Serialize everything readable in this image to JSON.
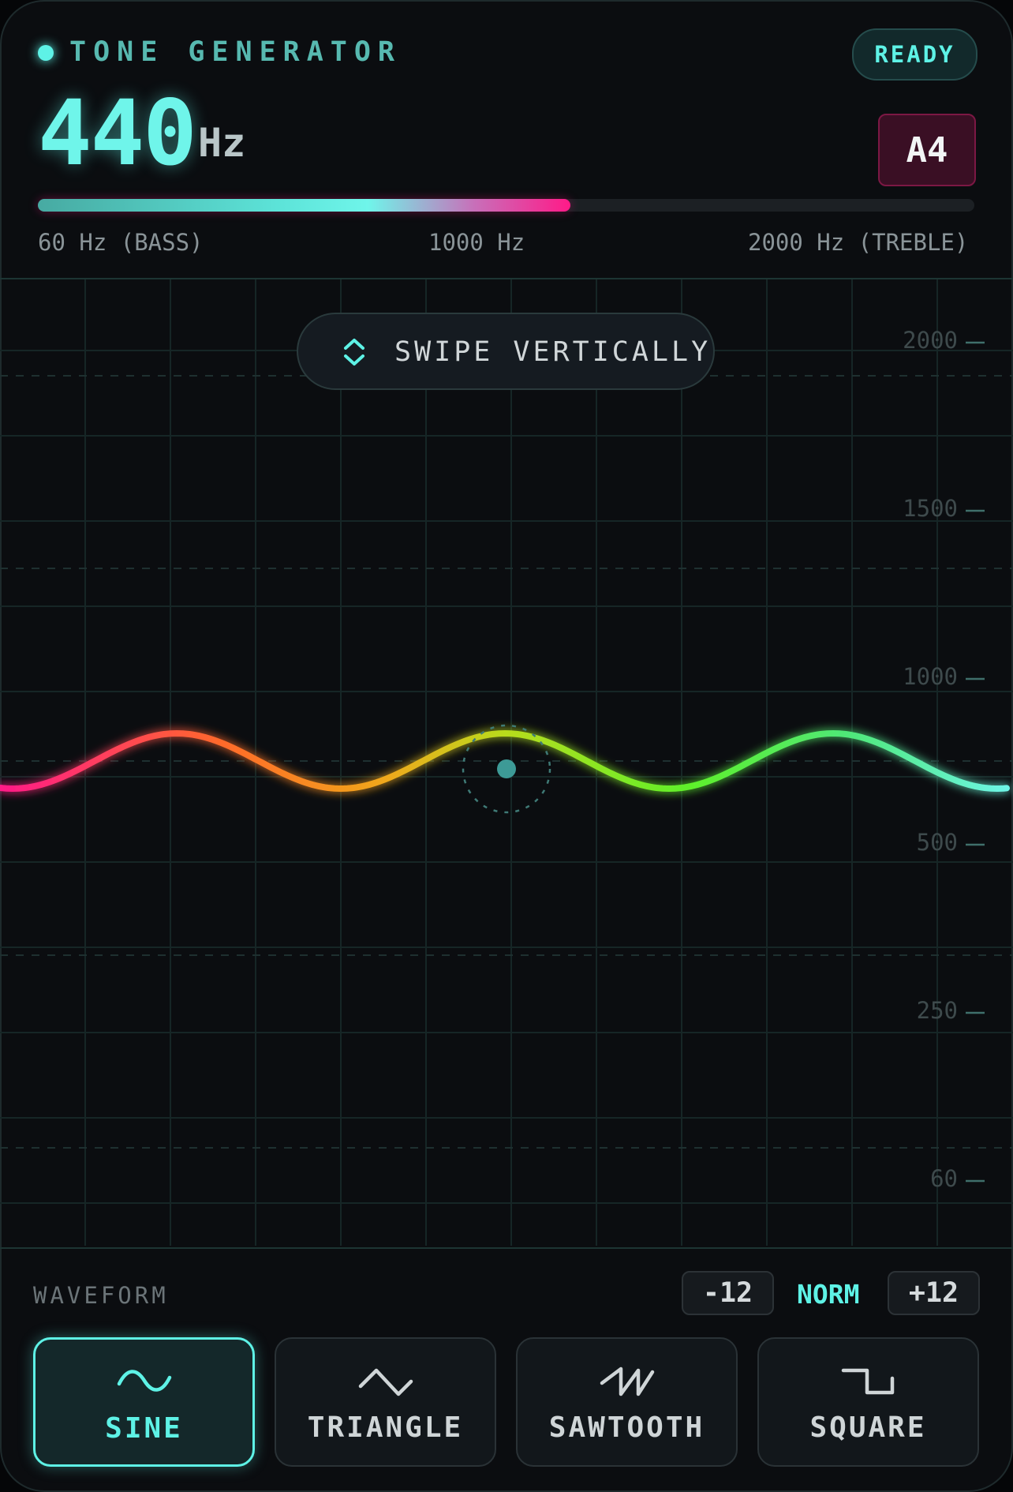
{
  "header": {
    "title": "TONE GENERATOR",
    "status": "READY",
    "frequency": "440",
    "unit": "Hz",
    "note": "A4"
  },
  "range_bar": {
    "fill_fraction": 0.569,
    "min_label": "60 Hz (BASS)",
    "mid_label": "1000 Hz",
    "max_label": "2000 Hz (TREBLE)"
  },
  "plot": {
    "hint": "SWIPE VERTICALLY",
    "ticks": [
      "2000",
      "1500",
      "1000",
      "500",
      "250",
      "60"
    ]
  },
  "waveform": {
    "label": "WAVEFORM",
    "minus": "-12",
    "norm": "NORM",
    "plus": "+12",
    "options": [
      {
        "label": "SINE",
        "icon": "sine-wave-icon",
        "active": true
      },
      {
        "label": "TRIANGLE",
        "icon": "triangle-wave-icon",
        "active": false
      },
      {
        "label": "SAWTOOTH",
        "icon": "sawtooth-wave-icon",
        "active": false
      },
      {
        "label": "SQUARE",
        "icon": "square-wave-icon",
        "active": false
      }
    ]
  },
  "colors": {
    "accent": "#5ef2e6",
    "note_bg": "#3a0f24",
    "wave_start": "#ff1a88",
    "wave_mid": "#5ef02a",
    "wave_end": "#6ff5ea"
  }
}
